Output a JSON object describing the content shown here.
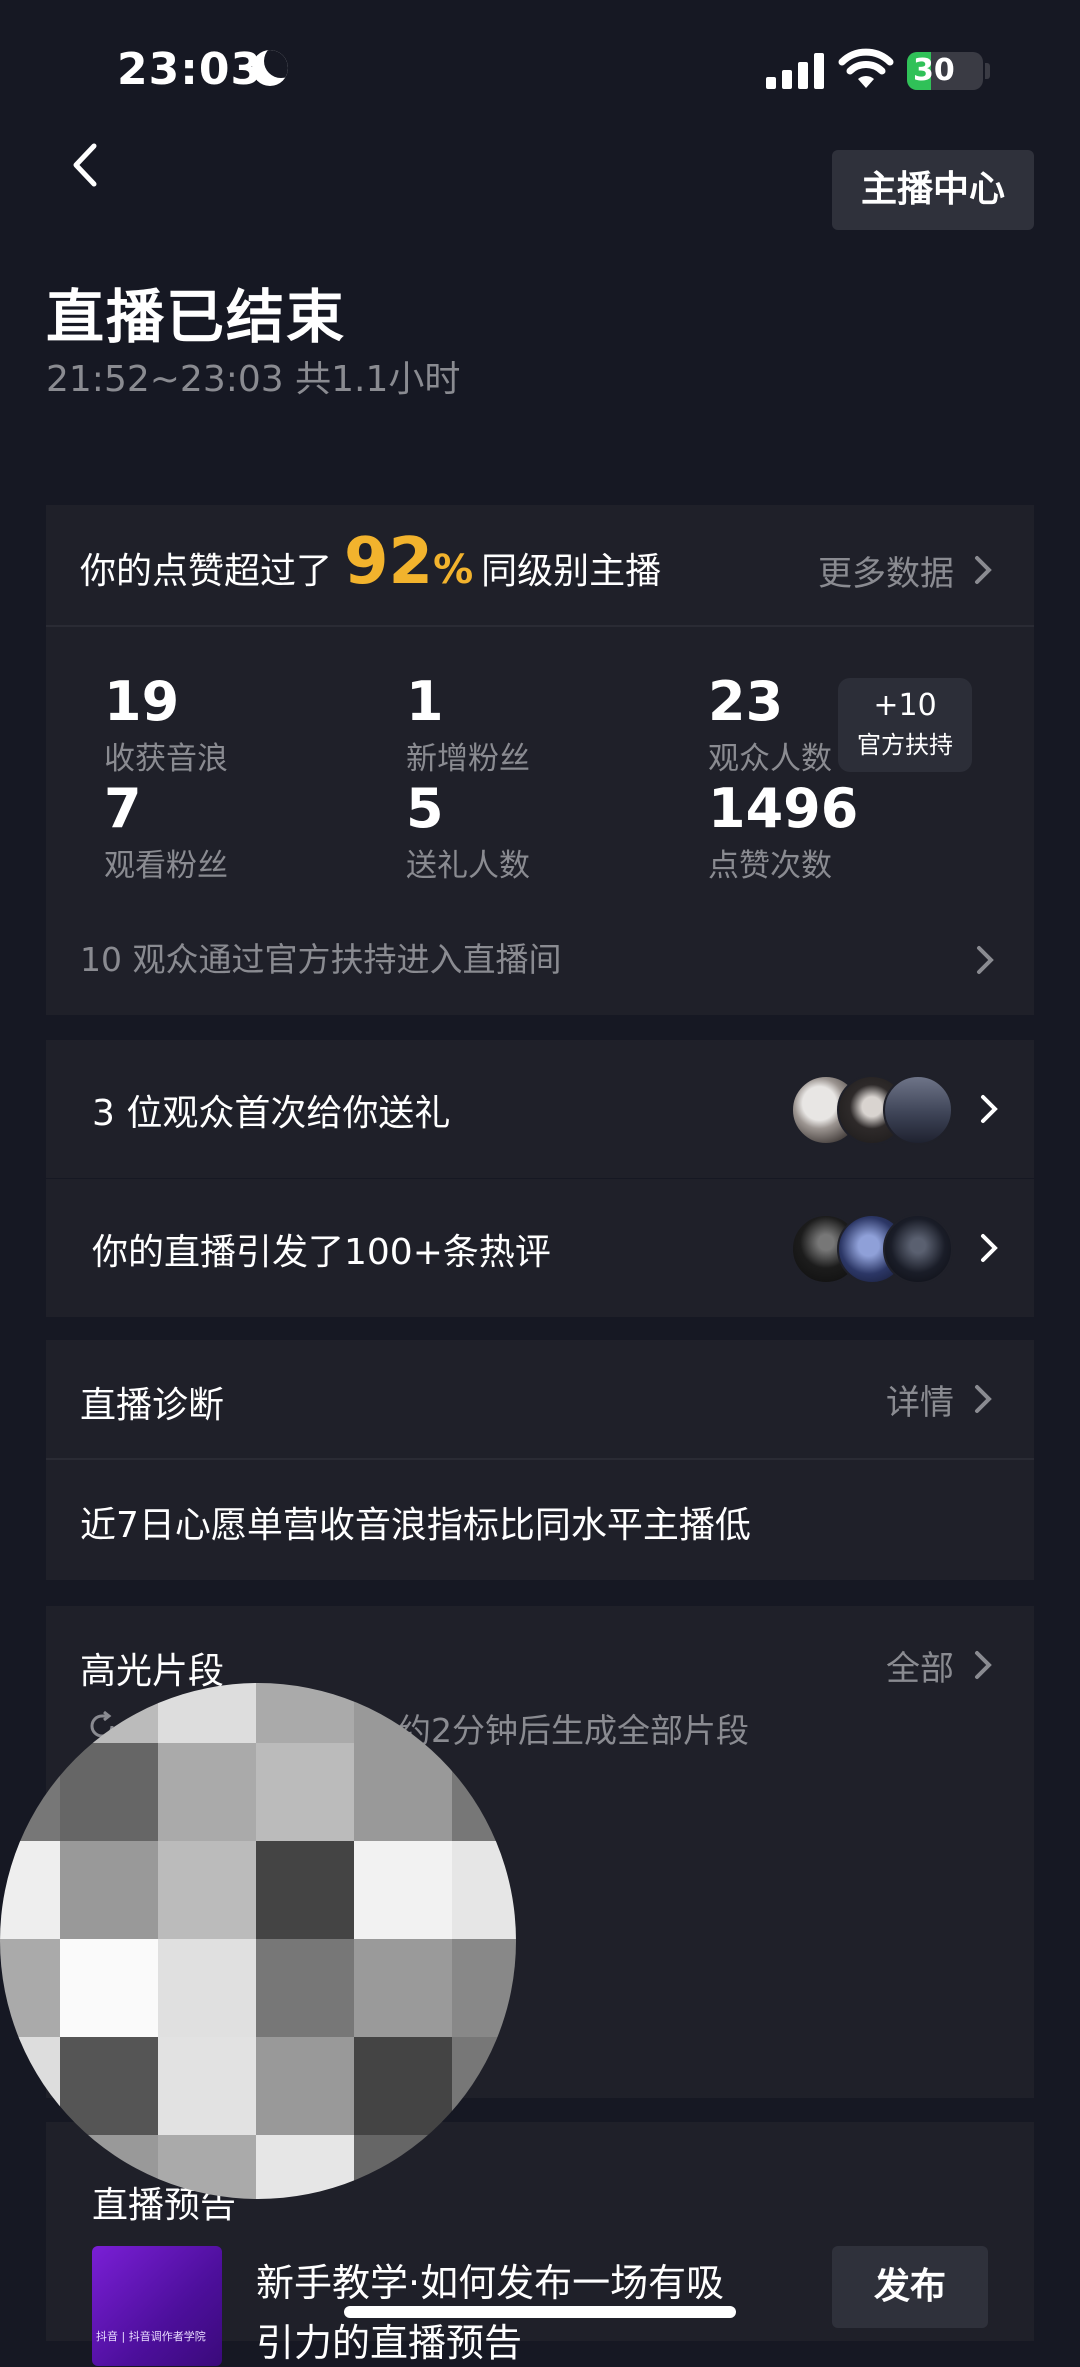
{
  "status_bar": {
    "time": "23:03",
    "battery": "30"
  },
  "header": {
    "host_center": "主播中心"
  },
  "page": {
    "title": "直播已结束",
    "subtitle": "21:52~23:03 共1.1小时"
  },
  "summary": {
    "prefix": "你的点赞超过了",
    "percent": "92",
    "percent_sign": "%",
    "suffix": "同级别主播",
    "more": "更多数据",
    "stats": [
      {
        "value": "19",
        "label": "收获音浪"
      },
      {
        "value": "1",
        "label": "新增粉丝"
      },
      {
        "value": "23",
        "label": "观众人数"
      },
      {
        "value": "7",
        "label": "观看粉丝"
      },
      {
        "value": "5",
        "label": "送礼人数"
      },
      {
        "value": "1496",
        "label": "点赞次数"
      }
    ],
    "badge_top": "+10",
    "badge_bottom": "官方扶持",
    "footer": "10 观众通过官方扶持进入直播间"
  },
  "gifts_row": {
    "label": "3 位观众首次给你送礼"
  },
  "comments_row": {
    "label": "你的直播引发了100+条热评"
  },
  "diagnosis": {
    "title": "直播诊断",
    "more": "详情",
    "text": "近7日心愿单营收音浪指标比同水平主播低"
  },
  "highlights": {
    "title": "高光片段",
    "more": "全部",
    "note": "约2分钟后生成全部片段"
  },
  "preview": {
    "title": "直播预告",
    "thumb_text": "抖音 | 抖音调作者学院",
    "line1": "新手教学·如何发布一场有吸",
    "line2": "引力的直播预告",
    "publish": "发布"
  },
  "colors": {
    "accent": "#f2b32d",
    "background": "#161823",
    "card": "#1f2029",
    "muted": "#8a8b91"
  }
}
